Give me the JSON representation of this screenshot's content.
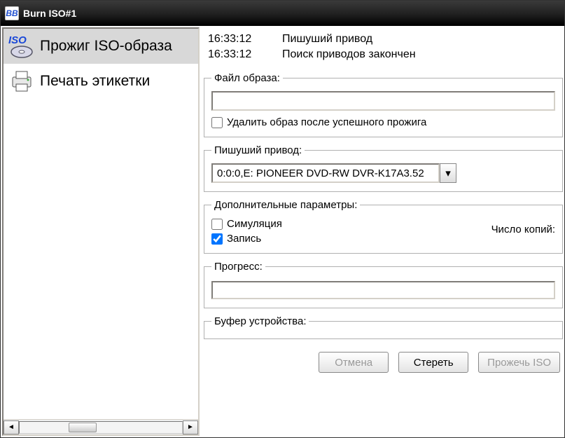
{
  "window": {
    "title": "Burn ISO#1",
    "icon_text": "BB"
  },
  "sidebar": {
    "items": [
      {
        "label": "Прожиг ISO-образа",
        "selected": true,
        "icon": "iso"
      },
      {
        "label": "Печать этикетки",
        "selected": false,
        "icon": "printer"
      }
    ]
  },
  "log": [
    {
      "time": "16:33:12",
      "msg": "Пишуший привод"
    },
    {
      "time": "16:33:12",
      "msg": "Поиск приводов закончен"
    }
  ],
  "image_file": {
    "legend": "Файл образа:",
    "value": "",
    "delete_after": {
      "label": "Удалить образ после успешного прожига",
      "checked": false
    }
  },
  "writer": {
    "legend": "Пишуший привод:",
    "selected": "0:0:0,E: PIONEER DVD-RW  DVR-K17A3.52"
  },
  "params": {
    "legend": "Дополнительные параметры:",
    "simulate": {
      "label": "Симуляция",
      "checked": false
    },
    "write": {
      "label": "Запись",
      "checked": true
    },
    "copies_label": "Число копий:"
  },
  "progress": {
    "legend": "Прогресс:"
  },
  "buffer": {
    "legend": "Буфер устройства:"
  },
  "buttons": {
    "cancel": "Отмена",
    "erase": "Стереть",
    "burn": "Прожечь ISO"
  }
}
